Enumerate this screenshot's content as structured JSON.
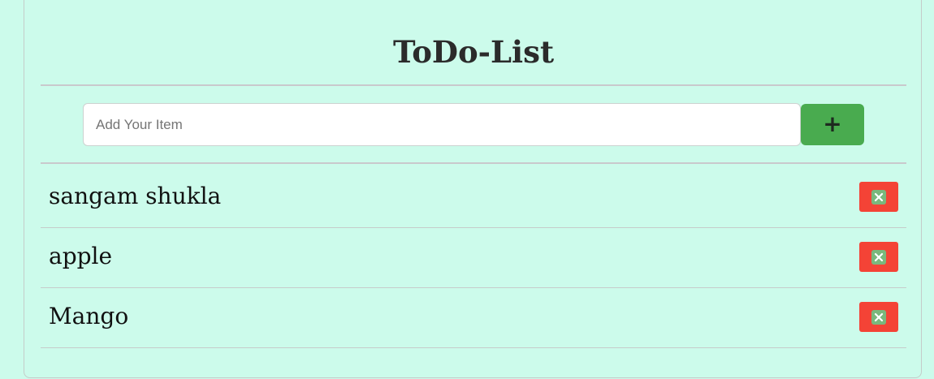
{
  "header": {
    "title": "ToDo-List"
  },
  "form": {
    "placeholder": "Add Your Item",
    "value": "",
    "add_label": "+"
  },
  "items": [
    {
      "text": "sangam shukla"
    },
    {
      "text": "apple"
    },
    {
      "text": "Mango"
    }
  ],
  "icons": {
    "delete": "close-box-icon"
  },
  "colors": {
    "background": "#ccfbeb",
    "add_button": "#49ab4f",
    "delete_button": "#f44336"
  }
}
